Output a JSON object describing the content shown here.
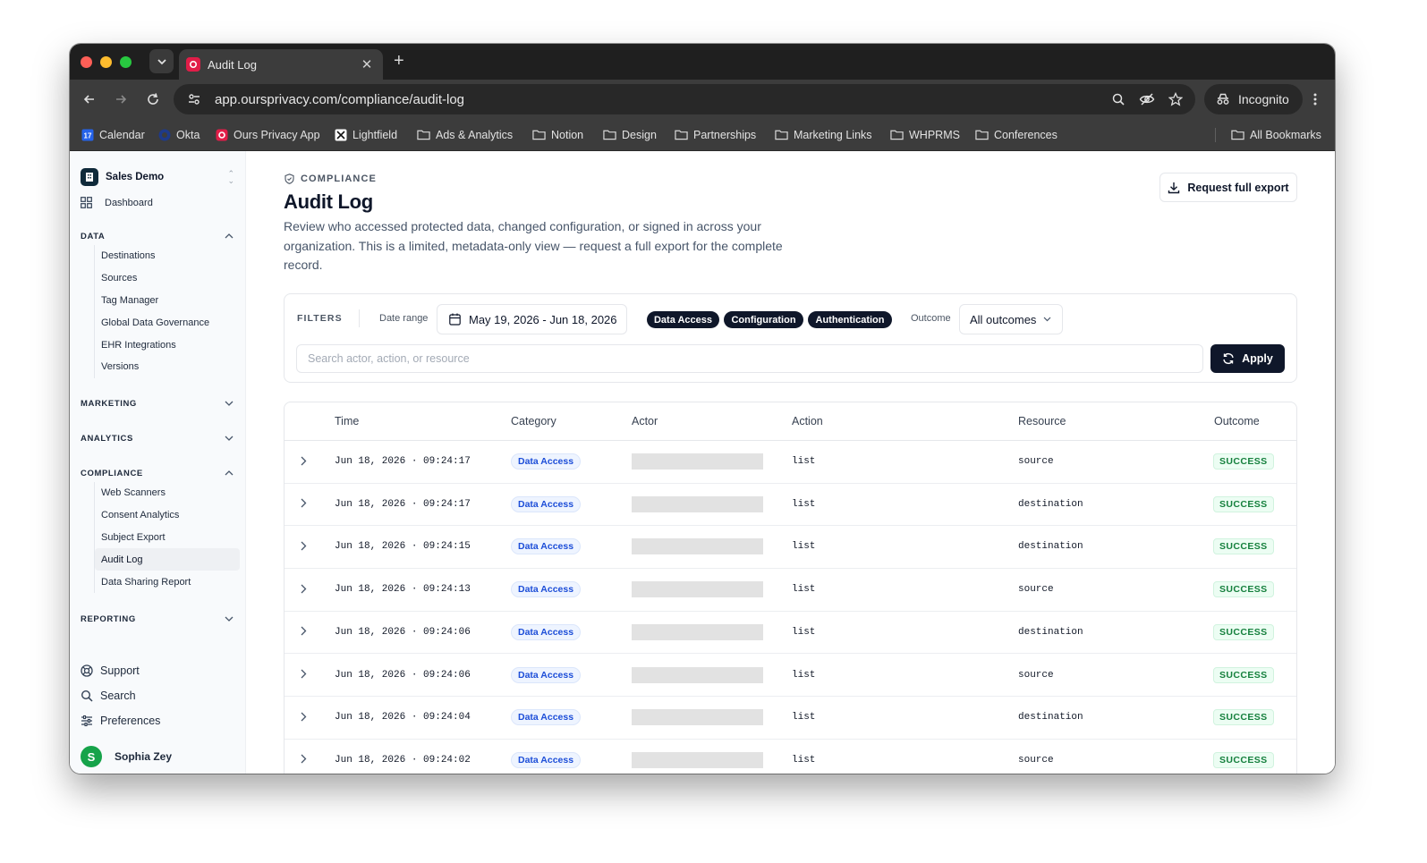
{
  "browser": {
    "tab_title": "Audit Log",
    "url": "app.oursprivacy.com/compliance/audit-log",
    "incognito_label": "Incognito",
    "bookmarks": [
      {
        "label": "Calendar",
        "icon": "calendar-icon"
      },
      {
        "label": "Okta",
        "icon": "okta-icon"
      },
      {
        "label": "Ours Privacy App",
        "icon": "ours-privacy-icon"
      },
      {
        "label": "Lightfield",
        "icon": "lightfield-icon"
      },
      {
        "label": "Ads & Analytics",
        "icon": "folder-icon"
      },
      {
        "label": "Notion",
        "icon": "folder-icon"
      },
      {
        "label": "Design",
        "icon": "folder-icon"
      },
      {
        "label": "Partnerships",
        "icon": "folder-icon"
      },
      {
        "label": "Marketing Links",
        "icon": "folder-icon"
      },
      {
        "label": "WHPRMS",
        "icon": "folder-icon"
      },
      {
        "label": "Conferences",
        "icon": "folder-icon"
      }
    ],
    "all_bookmarks_label": "All Bookmarks"
  },
  "sidebar": {
    "org_name": "Sales Demo",
    "dashboard_label": "Dashboard",
    "sections": {
      "data": {
        "label": "DATA",
        "items": [
          "Destinations",
          "Sources",
          "Tag Manager",
          "Global Data Governance",
          "EHR Integrations",
          "Versions"
        ]
      },
      "marketing": {
        "label": "MARKETING"
      },
      "analytics": {
        "label": "ANALYTICS"
      },
      "compliance": {
        "label": "COMPLIANCE",
        "items": [
          "Web Scanners",
          "Consent Analytics",
          "Subject Export",
          "Audit Log",
          "Data Sharing Report"
        ],
        "active": "Audit Log"
      },
      "reporting": {
        "label": "REPORTING"
      }
    },
    "footer": {
      "support": "Support",
      "search": "Search",
      "preferences": "Preferences",
      "user_name": "Sophia Zey",
      "user_initial": "S"
    }
  },
  "page": {
    "eyebrow": "COMPLIANCE",
    "title": "Audit Log",
    "description": "Review who accessed protected data, changed configuration, or signed in across your organization. This is a limited, metadata-only view — request a full export for the complete record.",
    "export_button": "Request full export"
  },
  "filters": {
    "label": "FILTERS",
    "date_range_label": "Date range",
    "date_range_value": "May 19, 2026 - Jun 18, 2026",
    "chips": [
      "Data Access",
      "Configuration",
      "Authentication"
    ],
    "outcome_label": "Outcome",
    "outcome_value": "All outcomes",
    "search_placeholder": "Search actor, action, or resource",
    "apply_label": "Apply"
  },
  "table": {
    "columns": [
      "Time",
      "Category",
      "Actor",
      "Action",
      "Resource",
      "Outcome"
    ],
    "rows": [
      {
        "time": "Jun 18, 2026 · 09:24:17",
        "category": "Data Access",
        "action": "list",
        "resource": "source",
        "outcome": "SUCCESS"
      },
      {
        "time": "Jun 18, 2026 · 09:24:17",
        "category": "Data Access",
        "action": "list",
        "resource": "destination",
        "outcome": "SUCCESS"
      },
      {
        "time": "Jun 18, 2026 · 09:24:15",
        "category": "Data Access",
        "action": "list",
        "resource": "destination",
        "outcome": "SUCCESS"
      },
      {
        "time": "Jun 18, 2026 · 09:24:13",
        "category": "Data Access",
        "action": "list",
        "resource": "source",
        "outcome": "SUCCESS"
      },
      {
        "time": "Jun 18, 2026 · 09:24:06",
        "category": "Data Access",
        "action": "list",
        "resource": "destination",
        "outcome": "SUCCESS"
      },
      {
        "time": "Jun 18, 2026 · 09:24:06",
        "category": "Data Access",
        "action": "list",
        "resource": "source",
        "outcome": "SUCCESS"
      },
      {
        "time": "Jun 18, 2026 · 09:24:04",
        "category": "Data Access",
        "action": "list",
        "resource": "destination",
        "outcome": "SUCCESS"
      },
      {
        "time": "Jun 18, 2026 · 09:24:02",
        "category": "Data Access",
        "action": "list",
        "resource": "source",
        "outcome": "SUCCESS"
      }
    ]
  }
}
